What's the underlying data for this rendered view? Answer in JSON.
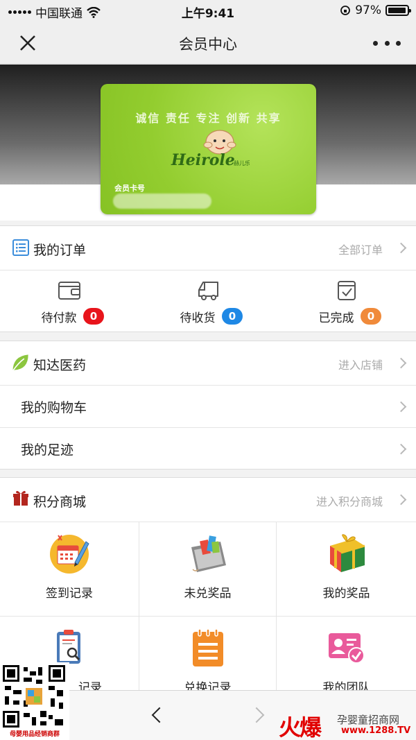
{
  "status_bar": {
    "carrier": "中国联通",
    "time": "上午9:41",
    "battery": "97%",
    "battery_level": 0.97
  },
  "nav": {
    "title": "会员中心"
  },
  "member_card": {
    "slogan": "诚信 责任 专注 创新 共享",
    "brand": "Heirole",
    "brand_cn": "赫儿乐",
    "number_label": "会员卡号"
  },
  "orders": {
    "title": "我的订单",
    "more": "全部订单",
    "items": [
      {
        "label": "待付款",
        "count": "0",
        "badge_color": "#e8141b"
      },
      {
        "label": "待收货",
        "count": "0",
        "badge_color": "#1e88e5"
      },
      {
        "label": "已完成",
        "count": "0",
        "badge_color": "#f08a3a"
      }
    ]
  },
  "store": {
    "title": "知达医药",
    "more": "进入店铺",
    "items": [
      {
        "label": "我的购物车"
      },
      {
        "label": "我的足迹"
      }
    ]
  },
  "points_mall": {
    "title": "积分商城",
    "more": "进入积分商城",
    "items": [
      {
        "label": "签到记录",
        "icon": "calendar-icon"
      },
      {
        "label": "未兑奖品",
        "icon": "gift-box-icon"
      },
      {
        "label": "我的奖品",
        "icon": "present-icon"
      },
      {
        "label": "记录",
        "icon": "clipboard-search-icon"
      },
      {
        "label": "兑换记录",
        "icon": "notepad-icon"
      },
      {
        "label": "我的团队",
        "icon": "team-card-icon"
      }
    ]
  },
  "qr": {
    "caption": "母婴用品经销商群"
  },
  "watermark": {
    "big": "火爆",
    "small": "孕婴童招商网",
    "url": "www.1288.TV"
  },
  "colors": {
    "card": "#9ad33a",
    "accent_blue": "#3b8ddb",
    "badge_red": "#e8141b",
    "badge_blue": "#1e88e5",
    "badge_orange": "#f08a3a",
    "leaf_green": "#8cc63f",
    "gift_red": "#b3261e"
  }
}
